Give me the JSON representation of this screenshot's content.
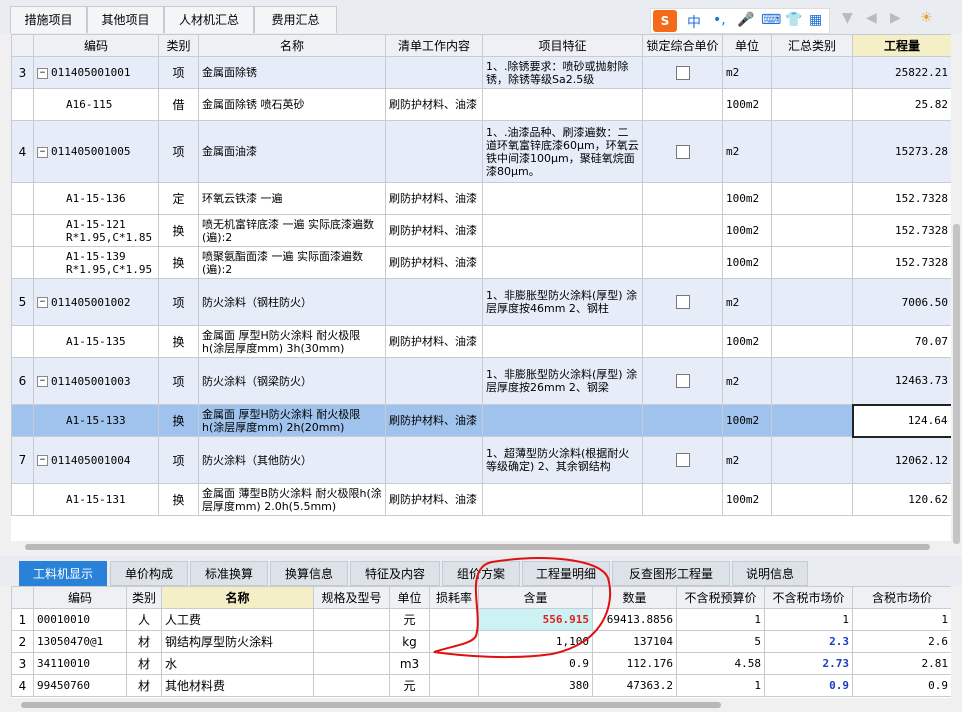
{
  "top_tabs": [
    "措施项目",
    "其他项目",
    "人材机汇总",
    "费用汇总"
  ],
  "ime": {
    "logo": "S",
    "items": [
      "中",
      "•,",
      "🎤",
      "⌨",
      "👕",
      "▦"
    ]
  },
  "toolbar_icons": [
    "▼",
    "◀",
    "▶",
    "☀"
  ],
  "main_headers": [
    "编码",
    "类别",
    "名称",
    "清单工作内容",
    "项目特征",
    "锁定综合单价",
    "单位",
    "汇总类别",
    "工程量"
  ],
  "rows": [
    {
      "no": "3",
      "code": "011405001001",
      "type": "项",
      "name": "金属面除锈",
      "content": "",
      "feature": "1、.除锈要求：喷砂或抛射除锈，除锈等级Sa2.5级",
      "lock": true,
      "unit": "m2",
      "sum": "",
      "qty": "25822.21",
      "kind": "item"
    },
    {
      "no": "",
      "code": "A16-115",
      "type": "借",
      "name": "金属面除锈 喷石英砂",
      "content": "刷防护材料、油漆",
      "feature": "",
      "lock": false,
      "unit": "100m2",
      "sum": "",
      "qty": "25.82",
      "kind": "sub"
    },
    {
      "no": "4",
      "code": "011405001005",
      "type": "项",
      "name": "金属面油漆",
      "content": "",
      "feature": "1、.油漆品种、刷漆遍数：二道环氧富锌底漆60μm，环氧云铁中间漆100μm，聚硅氧烷面漆80μm。",
      "lock": true,
      "unit": "m2",
      "sum": "",
      "qty": "15273.28",
      "kind": "item"
    },
    {
      "no": "",
      "code": "A1-15-136",
      "type": "定",
      "name": "环氧云铁漆 一遍",
      "content": "刷防护材料、油漆",
      "feature": "",
      "lock": false,
      "unit": "100m2",
      "sum": "",
      "qty": "152.7328",
      "kind": "sub"
    },
    {
      "no": "",
      "code": "A1-15-121 R*1.95,C*1.85",
      "type": "换",
      "name": "喷无机富锌底漆 一遍 实际底漆遍数(遍):2",
      "content": "刷防护材料、油漆",
      "feature": "",
      "lock": false,
      "unit": "100m2",
      "sum": "",
      "qty": "152.7328",
      "kind": "sub"
    },
    {
      "no": "",
      "code": "A1-15-139 R*1.95,C*1.95",
      "type": "换",
      "name": "喷聚氨酯面漆 一遍 实际面漆遍数(遍):2",
      "content": "刷防护材料、油漆",
      "feature": "",
      "lock": false,
      "unit": "100m2",
      "sum": "",
      "qty": "152.7328",
      "kind": "sub"
    },
    {
      "no": "5",
      "code": "011405001002",
      "type": "项",
      "name": "防火涂料（钢柱防火）",
      "content": "",
      "feature": "1、非膨胀型防火涂料(厚型) 涂层厚度按46mm 2、钢柱",
      "lock": true,
      "unit": "m2",
      "sum": "",
      "qty": "7006.50",
      "kind": "item"
    },
    {
      "no": "",
      "code": "A1-15-135",
      "type": "换",
      "name": "金属面 厚型H防火涂料 耐火极限h(涂层厚度mm) 3h(30mm)",
      "content": "刷防护材料、油漆",
      "feature": "",
      "lock": false,
      "unit": "100m2",
      "sum": "",
      "qty": "70.07",
      "kind": "sub"
    },
    {
      "no": "6",
      "code": "011405001003",
      "type": "项",
      "name": "防火涂料（钢梁防火）",
      "content": "",
      "feature": "1、非膨胀型防火涂料(厚型) 涂层厚度按26mm 2、钢梁",
      "lock": true,
      "unit": "m2",
      "sum": "",
      "qty": "12463.73",
      "kind": "item"
    },
    {
      "no": "",
      "code": "A1-15-133",
      "type": "换",
      "name": "金属面 厚型H防火涂料 耐火极限h(涂层厚度mm) 2h(20mm)",
      "content": "刷防护材料、油漆",
      "feature": "",
      "lock": false,
      "unit": "100m2",
      "sum": "",
      "qty": "124.64",
      "kind": "selrow"
    },
    {
      "no": "7",
      "code": "011405001004",
      "type": "项",
      "name": "防火涂料（其他防火）",
      "content": "",
      "feature": "1、超薄型防火涂料(根据耐火等级确定) 2、其余钢结构",
      "lock": true,
      "unit": "m2",
      "sum": "",
      "qty": "12062.12",
      "kind": "item"
    },
    {
      "no": "",
      "code": "A1-15-131",
      "type": "换",
      "name": "金属面 薄型B防火涂料 耐火极限h(涂层厚度mm) 2.0h(5.5mm)",
      "content": "刷防护材料、油漆",
      "feature": "",
      "lock": false,
      "unit": "100m2",
      "sum": "",
      "qty": "120.62",
      "kind": "sub"
    }
  ],
  "bottom_tabs": [
    "工料机显示",
    "单价构成",
    "标准换算",
    "换算信息",
    "特征及内容",
    "组价方案",
    "工程量明细",
    "反查图形工程量",
    "说明信息"
  ],
  "bottom_headers": [
    "编码",
    "类别",
    "名称",
    "规格及型号",
    "单位",
    "损耗率",
    "含量",
    "数量",
    "不含税预算价",
    "不含税市场价",
    "含税市场价"
  ],
  "bottom_rows": [
    {
      "no": "1",
      "code": "00010010",
      "type": "人",
      "name": "人工费",
      "spec": "",
      "unit": "元",
      "loss": "",
      "content": "556.915",
      "qty": "69413.8856",
      "budget": "1",
      "market": "1",
      "tax": "1"
    },
    {
      "no": "2",
      "code": "13050470@1",
      "type": "材",
      "name": "钢结构厚型防火涂料",
      "spec": "",
      "unit": "kg",
      "loss": "",
      "content": "1,100",
      "qty": "137104",
      "budget": "5",
      "market": "2.3",
      "tax": "2.6"
    },
    {
      "no": "3",
      "code": "34110010",
      "type": "材",
      "name": "水",
      "spec": "",
      "unit": "m3",
      "loss": "",
      "content": "0.9",
      "qty": "112.176",
      "budget": "4.58",
      "market": "2.73",
      "tax": "2.81"
    },
    {
      "no": "4",
      "code": "99450760",
      "type": "材",
      "name": "其他材料费",
      "spec": "",
      "unit": "元",
      "loss": "",
      "content": "380",
      "qty": "47363.2",
      "budget": "1",
      "market": "0.9",
      "tax": "0.9"
    }
  ],
  "colors": {
    "active_tab": "#2a82d8",
    "selected_row": "#9fc3ec",
    "item_row": "#e6edf8",
    "annotation": "#e01010",
    "highlight_text": "#e02020"
  }
}
